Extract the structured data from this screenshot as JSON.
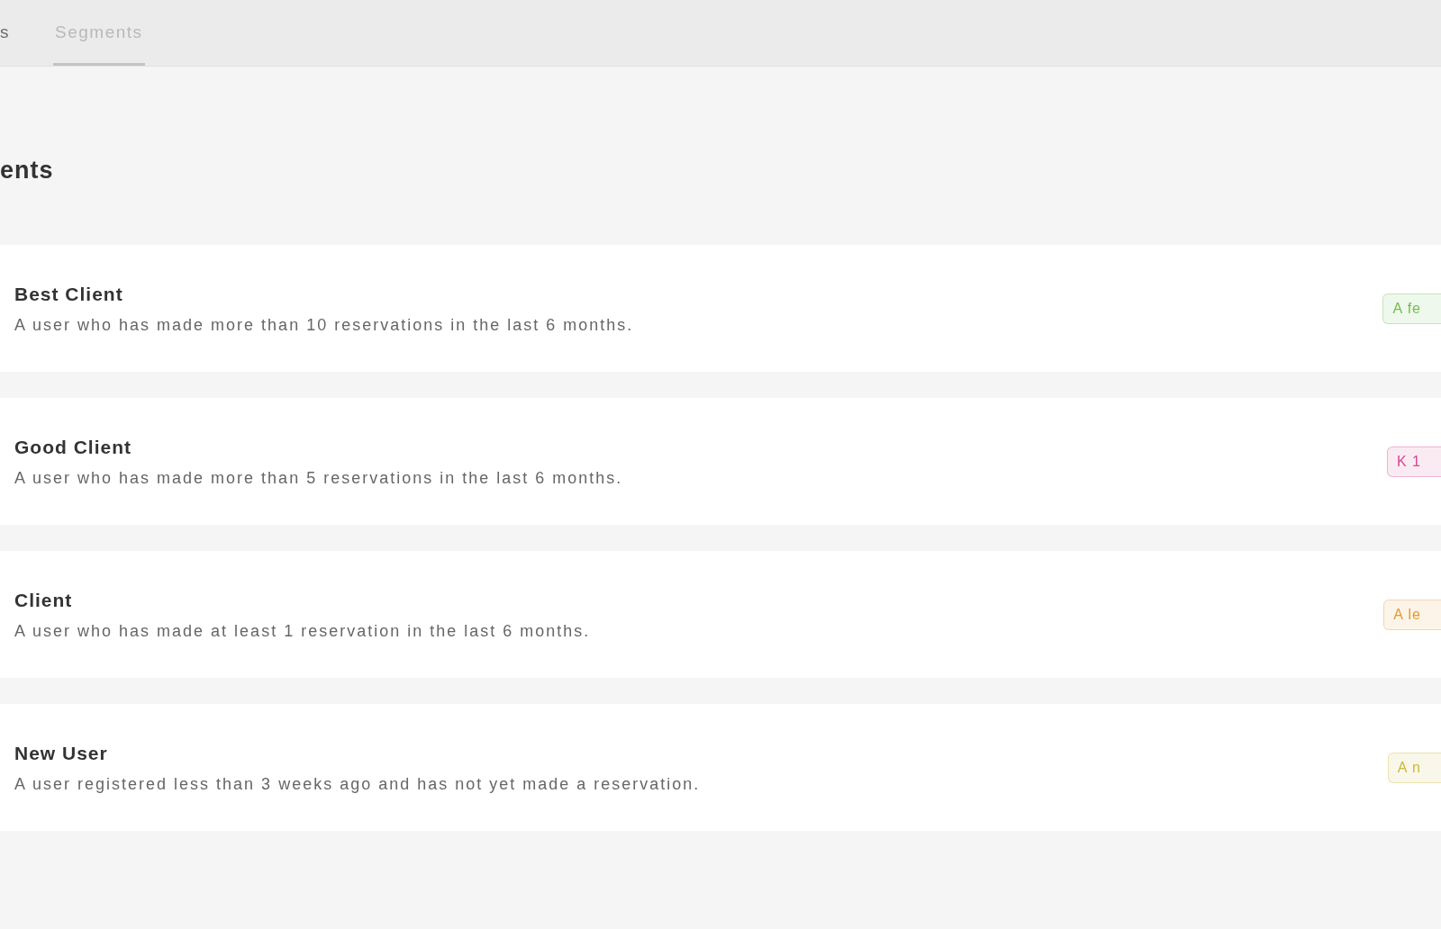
{
  "tabs": [
    {
      "label": "s",
      "selected": false
    },
    {
      "label": "Segments",
      "selected": true
    }
  ],
  "heading": "ents",
  "segments": [
    {
      "name": "Best Client",
      "description": "A user who has made more than 10 reservations in the last 6 months.",
      "badge": {
        "label": "A fe",
        "color": "#6fbf4f"
      }
    },
    {
      "name": "Good Client",
      "description": "A user who has made more than 5 reservations in the last 6 months.",
      "badge": {
        "label": "K 1",
        "color": "#d6478f"
      }
    },
    {
      "name": "Client",
      "description": "A user who has made at least 1 reservation in the last 6 months.",
      "badge": {
        "label": "A le",
        "color": "#e39a2d"
      }
    },
    {
      "name": "New User",
      "description": "A user registered less than 3 weeks ago and has not yet made a reservation.",
      "badge": {
        "label": "A n",
        "color": "#c9b93a"
      }
    }
  ]
}
